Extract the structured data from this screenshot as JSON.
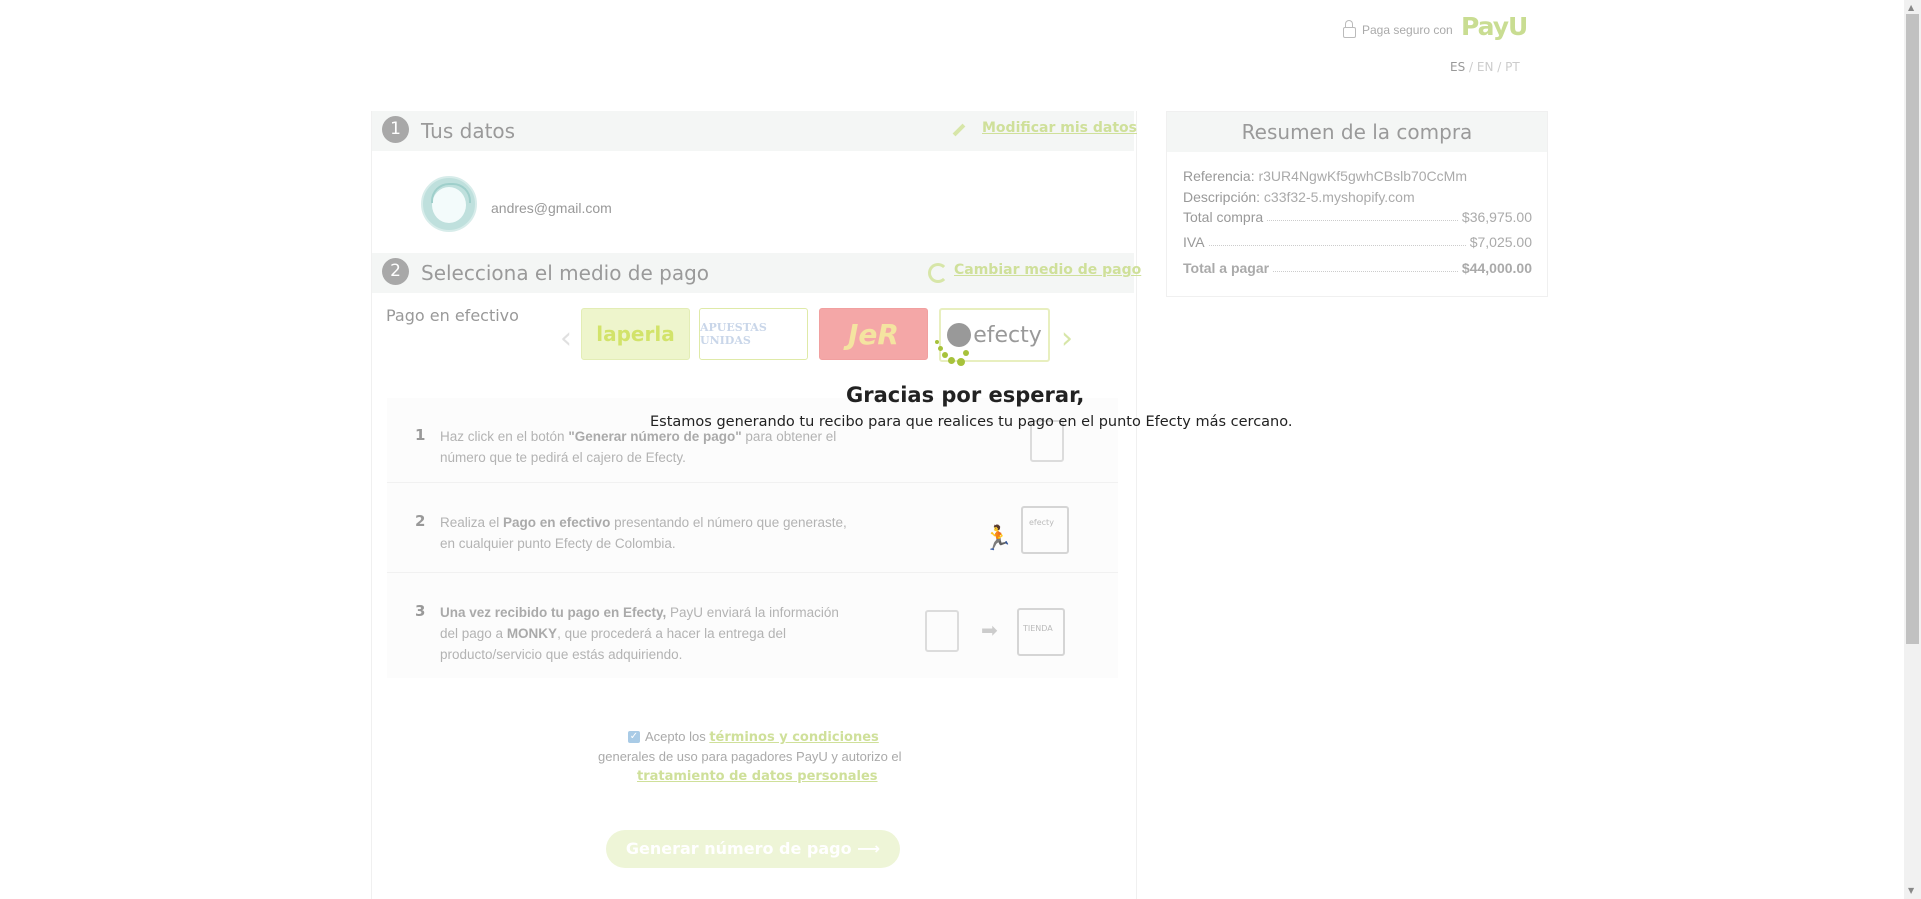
{
  "header": {
    "secure_text": "Paga seguro con",
    "brand": "PayU",
    "langs": [
      "ES",
      "EN",
      "PT"
    ],
    "lang_sep": "/"
  },
  "section1": {
    "number": "1",
    "title": "Tus datos",
    "modify_link": "Modificar mis datos",
    "email": "andres@gmail.com"
  },
  "section2": {
    "number": "2",
    "title": "Selecciona el medio de pago",
    "change_link": "Cambiar medio de pago",
    "pago_label": "Pago en efectivo",
    "methods": [
      {
        "name": "laperla",
        "label": "laperla"
      },
      {
        "name": "apuestas-unidas",
        "label": "APUESTAS UNIDAS"
      },
      {
        "name": "jer",
        "label": "JeR"
      },
      {
        "name": "efecty",
        "label": "efecty"
      }
    ],
    "steps": [
      {
        "num": "1",
        "pre": "Haz click en el botón ",
        "bold": "\"Generar número de pago\"",
        "post": " para obtener el número que te pedirá el cajero de Efecty."
      },
      {
        "num": "2",
        "pre": "Realiza el ",
        "bold": "Pago en efectivo",
        "post": " presentando el número que generaste, en cualquier punto Efecty de Colombia."
      },
      {
        "num": "3",
        "bold": "Una vez recibido tu pago en Efecty,",
        "mid": " PayU enviará la información del pago a ",
        "bold2": "MONKY",
        "post": ", que procederá a hacer la entrega del producto/servicio que estás adquiriendo."
      }
    ],
    "store_label": "efecty",
    "tienda_label": "TIENDA"
  },
  "terms": {
    "accept": "Acepto los ",
    "link1": "términos y condiciones",
    "middle": "generales de uso para pagadores PayU y autorizo el",
    "link2": "tratamiento de datos personales"
  },
  "button": {
    "label": "Generar número de pago",
    "arrow": "⟶"
  },
  "summary": {
    "title": "Resumen de la compra",
    "referencia_label": "Referencia:",
    "referencia": "r3UR4NgwKf5gwhCBslb70CcMm",
    "descripcion_label": "Descripción:",
    "descripcion": "c33f32-5.myshopify.com",
    "total_compra_label": "Total compra",
    "total_compra": "$36,975.00",
    "iva_label": "IVA",
    "iva": "$7,025.00",
    "total_label": "Total a pagar",
    "total": "$44,000.00"
  },
  "overlay": {
    "title": "Gracias por esperar,",
    "subtitle": "Estamos generando tu recibo para que realices tu pago en el punto Efecty más cercano."
  },
  "colors": {
    "accent": "#a7c23b",
    "payu": "#c9dd92"
  }
}
